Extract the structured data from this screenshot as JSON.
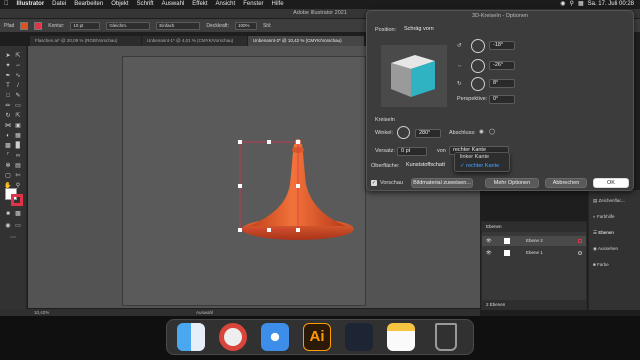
{
  "menubar": {
    "apple": "",
    "items": [
      "Illustrator",
      "Datei",
      "Bearbeiten",
      "Objekt",
      "Schrift",
      "Auswahl",
      "Effekt",
      "Ansicht",
      "Fenster",
      "Hilfe"
    ],
    "datetime": "Sa. 17. Juli 00:28"
  },
  "app_title": "Adobe Illustrator 2021",
  "control_bar": {
    "pfad_label": "Pfad",
    "kontur_label": "Kontur:",
    "stroke_value": "10 pt",
    "stroke_style_1": "Gleichm.",
    "stroke_style_2": "Einfach",
    "opacity_label": "Deckkraft:",
    "opacity_value": "100%",
    "style_label": "Stil:"
  },
  "tabs": [
    "Flaschen.ai* @ 20,08 % (RGB/Vorschau)",
    "Unbenannt-1* @ 4,01 % (CMYK/Vorschau)",
    "Unbenannt-2* @ 10,42 % (CMYK/Vorschau)"
  ],
  "status": {
    "zoom": "10,42%",
    "tool": "Auswahl"
  },
  "dialog": {
    "title": "3D-Kreiseln - Optionen",
    "position_label": "Position:",
    "position_value": "Schräg vorn",
    "rot_x": "-18°",
    "rot_y": "-26°",
    "rot_z": "8°",
    "perspective_label": "Perspektive:",
    "perspective_value": "0°",
    "section_label": "Kreiseln",
    "angle_label": "Winkel:",
    "angle_value": "280°",
    "cap_label": "Abschluss:",
    "offset_label": "Versatz:",
    "offset_value": "0 pt",
    "from_label": "von",
    "from_value": "rechter Kante",
    "surface_label": "Oberfläche:",
    "surface_value": "Kunststoffschatt",
    "preview_label": "Vorschau",
    "btn_map": "Bildmaterial zuweisen...",
    "btn_more": "Mehr Optionen",
    "btn_cancel": "Abbrechen",
    "btn_ok": "OK",
    "cube_color": "#2fb3c3"
  },
  "dropdown": {
    "options": [
      "linker Kante",
      "rechter Kante"
    ],
    "selected_index": 1
  },
  "right_panel": {
    "items": [
      "Zeichenflac...",
      "Farbhilfe",
      "Ebenen",
      "Aussehen",
      "Farbe"
    ]
  },
  "layers": {
    "title": "Ebenen",
    "rows": [
      "Ebene 2",
      "Ebene 1"
    ],
    "count": "2 Ebenen"
  },
  "dock": {
    "apps": [
      "Finder",
      "Chrome",
      "Safari",
      "Illustrator",
      "DaVinci Resolve",
      "Notes",
      "Trash"
    ],
    "ai_label": "Ai"
  },
  "colors": {
    "accent": "#4aa3ff",
    "shape_orange": "#e0531f",
    "selection_red": "#e0334a"
  }
}
